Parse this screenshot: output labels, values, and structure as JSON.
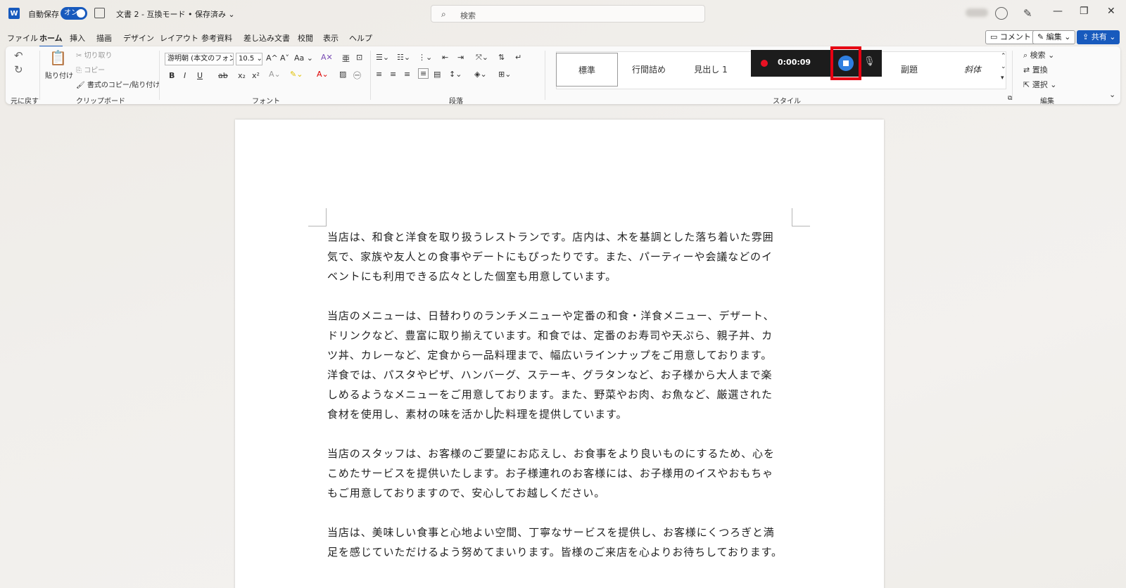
{
  "titlebar": {
    "app_icon": "word-icon",
    "app_icon_letter": "W",
    "autosave_label": "自動保存",
    "autosave_state": "オン",
    "doc_title": "文書 2 - 互換モード • 保存済み ⌄",
    "search_placeholder": "検索",
    "window_controls": [
      "—",
      "❐",
      "✕"
    ]
  },
  "menu": {
    "tabs": [
      "ファイル",
      "ホーム",
      "挿入",
      "描画",
      "デザイン",
      "レイアウト",
      "参考資料",
      "差し込み文書",
      "校閲",
      "表示",
      "ヘルプ"
    ],
    "active_tab": "ホーム",
    "comment_btn": "コメント",
    "edit_btn": "編集 ⌄",
    "share_btn": "共有 ⌄"
  },
  "ribbon": {
    "undo_group_label": "元に戻す",
    "clipboard": {
      "paste": "貼り付け",
      "cut": "切り取り",
      "copy": "コピー",
      "format_painter": "書式のコピー/貼り付け",
      "label": "クリップボード"
    },
    "font": {
      "font_name": "游明朝 (本文のフォン ⌄",
      "font_size": "10.5 ⌄",
      "grow": "A^",
      "shrink": "A˅",
      "case": "Aa ⌄",
      "bold": "B",
      "italic": "I",
      "underline": "U",
      "strike": "ab",
      "subscript": "x₂",
      "superscript": "x²",
      "label": "フォント"
    },
    "paragraph": {
      "label": "段落"
    },
    "styles": {
      "items": [
        "標準",
        "行間詰め",
        "見出し 1",
        "副題",
        "斜体"
      ],
      "selected": "標準",
      "label": "スタイル"
    },
    "editing": {
      "find": "検索 ⌄",
      "replace": "置換",
      "select": "選択 ⌄",
      "label": "編集"
    },
    "recorder": {
      "time": "0:00:09",
      "record_color": "#e81123",
      "stop_color": "#2f7fe0",
      "highlight_color": "#e60012"
    }
  },
  "document": {
    "paragraphs": [
      [
        "当店は、和食と洋食を取り扱うレストランです。店内は、木を基調とした落ち着いた雰囲",
        "気で、家族や友人との食事やデートにもぴったりです。また、パーティーや会議などのイ",
        "ベントにも利用できる広々とした個室も用意しています。"
      ],
      [
        "当店のメニューは、日替わりのランチメニューや定番の和食・洋食メニュー、デザート、",
        "ドリンクなど、豊富に取り揃えています。和食では、定番のお寿司や天ぷら、親子丼、カ",
        "ツ丼、カレーなど、定食から一品料理まで、幅広いラインナップをご用意しております。",
        "洋食では、パスタやピザ、ハンバーグ、ステーキ、グラタンなど、お子様から大人まで楽",
        "しめるようなメニューをご用意しております。また、野菜やお肉、お魚など、厳選された",
        "食材を使用し、素材の味を活かし",
        "た料理を提供しています。"
      ],
      [
        "当店のスタッフは、お客様のご要望にお応えし、お食事をより良いものにするため、心を",
        "こめたサービスを提供いたします。お子様連れのお客様には、お子様用のイスやおもちゃ",
        "もご用意しておりますので、安心してお越しください。"
      ],
      [
        "当店は、美味しい食事と心地よい空間、丁寧なサービスを提供し、お客様にくつろぎと満",
        "足を感じていただけるよう努めてまいります。皆様のご来店を心よりお待ちしております。"
      ]
    ]
  },
  "colors": {
    "accent": "#185abd"
  }
}
